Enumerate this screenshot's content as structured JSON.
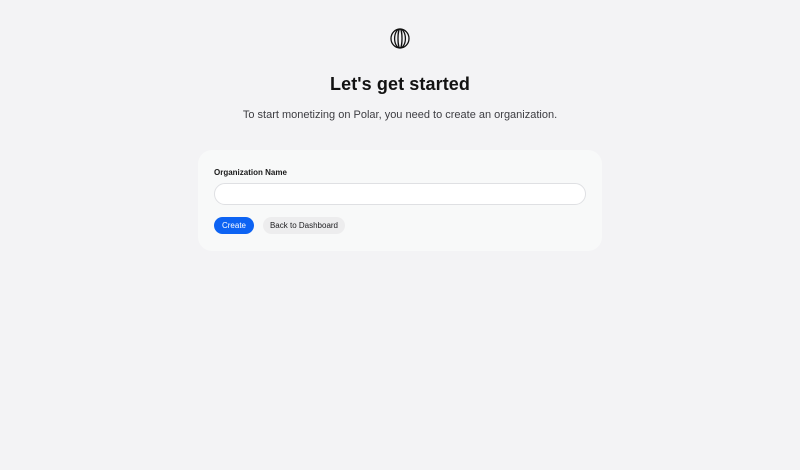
{
  "brand": {
    "logo_icon": "polar-globe-icon",
    "accent_color": "#0d63f3"
  },
  "page": {
    "title": "Let's get started",
    "subtitle": "To start monetizing on Polar, you need to create an organization."
  },
  "form": {
    "org_name_label": "Organization Name",
    "org_name_value": "",
    "org_name_placeholder": "",
    "create_label": "Create",
    "back_label": "Back to Dashboard"
  }
}
